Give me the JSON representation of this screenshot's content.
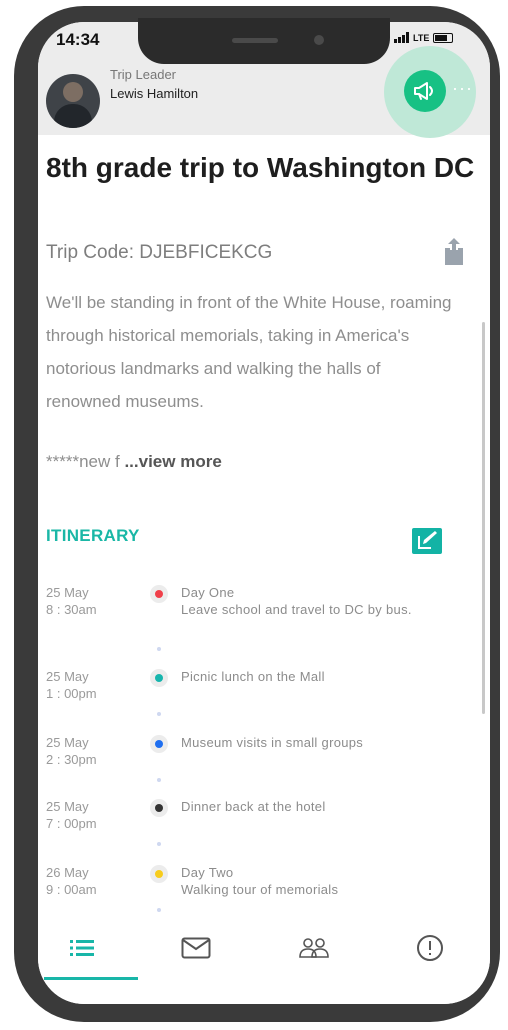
{
  "status_bar": {
    "time": "14:34",
    "network": "LTE"
  },
  "leader": {
    "role": "Trip Leader",
    "name": "Lewis Hamilton"
  },
  "icons": {
    "announce": "megaphone-icon",
    "more": "more-dots-icon",
    "share": "share-icon",
    "edit": "edit-icon",
    "tabs": [
      "list-icon",
      "mail-icon",
      "group-icon",
      "alert-icon"
    ]
  },
  "more_label": "···",
  "trip": {
    "title": "8th grade trip to Washington DC",
    "code_label": "Trip Code: DJEBFICEKCG",
    "description": "We'll be standing in front of the White House, roaming through historical memorials, taking in America's notorious landmarks and walking the halls of renowned museums.",
    "truncated_text": "*****new f",
    "view_more": "...view more"
  },
  "itinerary": {
    "heading": "ITINERARY",
    "items": [
      {
        "date": "25 May",
        "time": "8 : 30am",
        "text": "Day One\nLeave school and travel to DC by bus.",
        "color": "#f0404a"
      },
      {
        "date": "25 May",
        "time": "1 : 00pm",
        "text": "Picnic lunch on the Mall",
        "color": "#17b5ad"
      },
      {
        "date": "25 May",
        "time": "2 : 30pm",
        "text": "Museum visits in small groups",
        "color": "#1f6ff0"
      },
      {
        "date": "25 May",
        "time": "7 : 00pm",
        "text": "Dinner back at the hotel",
        "color": "#333333"
      },
      {
        "date": "26 May",
        "time": "9 : 00am",
        "text": "Day Two\nWalking tour of memorials",
        "color": "#f7cc1c"
      }
    ]
  },
  "colors": {
    "accent": "#18b6a8",
    "fab": "#17c184",
    "title": "#1e1e1e"
  },
  "bottom_nav": {
    "active_index": 0
  }
}
